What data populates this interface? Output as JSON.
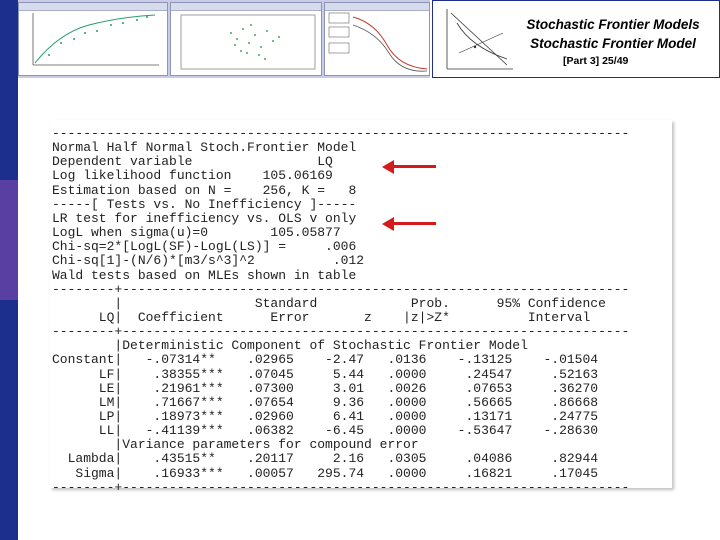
{
  "slide": {
    "title_line1": "Stochastic Frontier Models",
    "title_line2": "Stochastic Frontier Model",
    "part": "[Part  3]   25/49"
  },
  "colors": {
    "sidebar": "#1d2f8c",
    "sidebar_accent": "#5a3fa3",
    "arrow": "#d41b1b"
  },
  "output_lines": [
    "--------------------------------------------------------------------------",
    "Normal Half Normal Stoch.Frontier Model",
    "Dependent variable                LQ",
    "Log likelihood function    105.06169",
    "Estimation based on N =    256, K =   8",
    "-----[ Tests vs. No Inefficiency ]-----",
    "LR test for inefficiency vs. OLS v only",
    "LogL when sigma(u)=0        105.05877",
    "Chi-sq=2*[LogL(SF)-LogL(LS)] =     .006",
    "Chi-sq[1]-(N/6)*[m3/s^3]^2          .012",
    "Wald tests based on MLEs shown in table",
    "--------+-----------------------------------------------------------------",
    "        |                 Standard            Prob.      95% Confidence",
    "      LQ|  Coefficient      Error       z    |z|>Z*          Interval",
    "--------+-----------------------------------------------------------------",
    "        |Deterministic Component of Stochastic Frontier Model",
    "Constant|   -.07314**    .02965    -2.47   .0136    -.13125    -.01504",
    "      LF|    .38355***   .07045     5.44   .0000     .24547     .52163",
    "      LE|    .21961***   .07300     3.01   .0026     .07653     .36270",
    "      LM|    .71667***   .07654     9.36   .0000     .56665     .86668",
    "      LP|    .18973***   .02960     6.41   .0000     .13171     .24775",
    "      LL|   -.41139***   .06382    -6.45   .0000    -.53647    -.28630",
    "        |Variance parameters for compound error",
    "  Lambda|    .43515**    .20117     2.16   .0305     .04086     .82944",
    "   Sigma|    .16933***   .00057   295.74   .0000     .16821     .17045",
    "--------+-----------------------------------------------------------------"
  ]
}
